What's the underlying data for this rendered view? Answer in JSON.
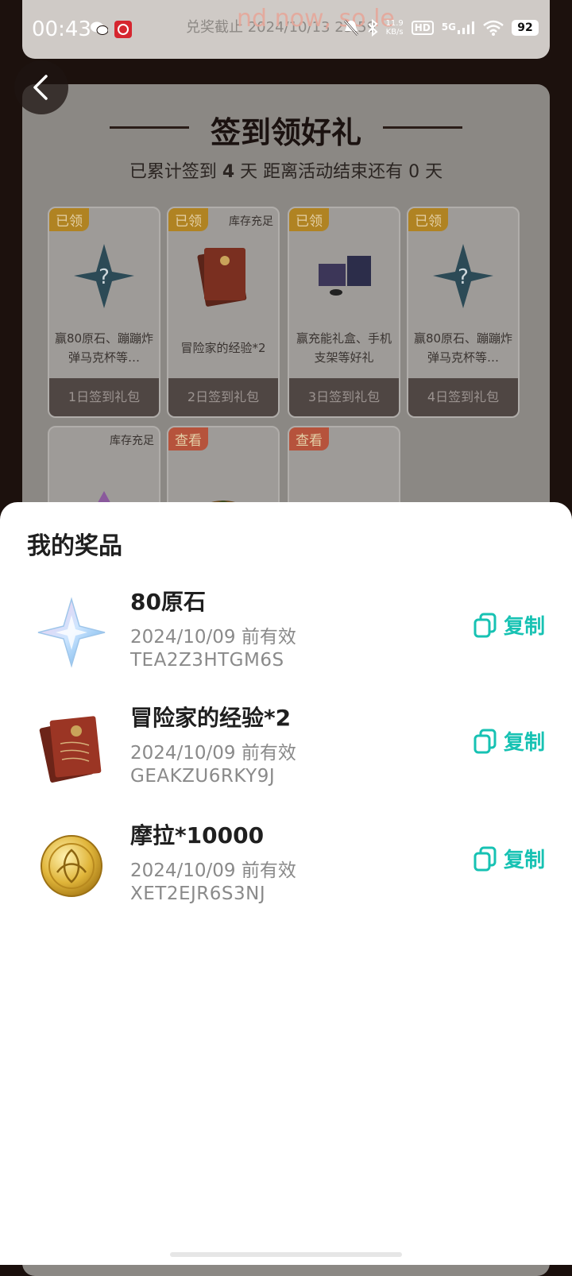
{
  "status_bar": {
    "time": "00:43",
    "net_speed_value": "11.9",
    "net_speed_unit": "KB/s",
    "hd": "HD",
    "network": "5G",
    "battery": "92"
  },
  "background": {
    "redeem_deadline": "兑奖截止 2024/10/13 23:59",
    "marquee_text": "nd now, so le",
    "panel_title": "签到领好礼",
    "subtitle_pre": "已累计签到",
    "signin_days": "4",
    "subtitle_mid": "天  距离活动结束还有",
    "days_left": "0",
    "subtitle_post": "天",
    "reward_cards": [
      {
        "badge": "已领",
        "stock": "",
        "desc": "赢80原石、蹦蹦炸弹马克杯等…",
        "day": "1日签到礼包"
      },
      {
        "badge": "已领",
        "stock": "库存充足",
        "desc": "冒险家的经验*2",
        "day": "2日签到礼包"
      },
      {
        "badge": "已领",
        "stock": "",
        "desc": "赢充能礼盒、手机支架等好礼",
        "day": "3日签到礼包"
      },
      {
        "badge": "已领",
        "stock": "",
        "desc": "赢80原石、蹦蹦炸弹马克杯等…",
        "day": "4日签到礼包"
      },
      {
        "badge": "",
        "stock": "库存充足",
        "desc": "",
        "day": ""
      },
      {
        "badge": "查看",
        "stock": "",
        "desc": "",
        "day": ""
      },
      {
        "badge": "查看",
        "stock": "",
        "desc": "",
        "day": ""
      }
    ]
  },
  "sheet": {
    "title": "我的奖品",
    "copy_label": "复制",
    "prizes": [
      {
        "name": "80原石",
        "valid": "2024/10/09 前有效",
        "code": "TEA2Z3HTGM6S",
        "icon": "primogem-icon"
      },
      {
        "name": "冒险家的经验*2",
        "valid": "2024/10/09 前有效",
        "code": "GEAKZU6RKY9J",
        "icon": "adventurer-experience-icon"
      },
      {
        "name": "摩拉*10000",
        "valid": "2024/10/09 前有效",
        "code": "XET2EJR6S3NJ",
        "icon": "mora-coin-icon"
      }
    ]
  }
}
